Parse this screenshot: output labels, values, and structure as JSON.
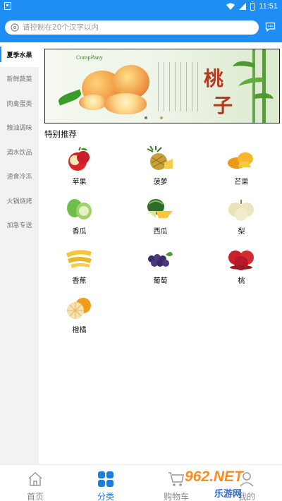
{
  "status_bar": {
    "time": "11:51",
    "colors": {
      "bar": "#1e8ef5"
    },
    "icons": [
      "notification-icon",
      "wifi-icon",
      "signal-icon",
      "battery-icon"
    ]
  },
  "search": {
    "placeholder": "请控制在20个汉字以内",
    "icon": "search-icon",
    "message_icon": "message-icon"
  },
  "sidebar": {
    "items": [
      {
        "label": "夏季水果",
        "active": true
      },
      {
        "label": "新鲜蔬菜"
      },
      {
        "label": "肉禽蛋类"
      },
      {
        "label": "粮油调味"
      },
      {
        "label": "酒水饮品"
      },
      {
        "label": "速食冷冻"
      },
      {
        "label": "火锅烧烤"
      },
      {
        "label": "加急专送"
      }
    ]
  },
  "banner": {
    "logo_text": "CompPany",
    "title_chars": [
      "桃",
      "子"
    ]
  },
  "main": {
    "section_title": "特别推荐",
    "products": [
      {
        "label": "苹果",
        "icon": "apple-icon"
      },
      {
        "label": "菠萝",
        "icon": "pineapple-icon"
      },
      {
        "label": "芒果",
        "icon": "mango-icon"
      },
      {
        "label": "香瓜",
        "icon": "melon-icon"
      },
      {
        "label": "西瓜",
        "icon": "watermelon-icon"
      },
      {
        "label": "梨",
        "icon": "pear-icon"
      },
      {
        "label": "香蕉",
        "icon": "banana-icon"
      },
      {
        "label": "葡萄",
        "icon": "grape-icon"
      },
      {
        "label": "桃",
        "icon": "peach-icon"
      },
      {
        "label": "橙橘",
        "icon": "orange-icon"
      }
    ]
  },
  "tabbar": {
    "tabs": [
      {
        "label": "首页",
        "icon": "home-icon"
      },
      {
        "label": "分类",
        "icon": "category-icon",
        "active": true
      },
      {
        "label": "购物车",
        "icon": "cart-icon"
      },
      {
        "label": "我的",
        "icon": "user-icon"
      }
    ],
    "active_color": "#1e7be0"
  },
  "watermark": {
    "top": "962.NET",
    "bottom": "乐游网"
  }
}
